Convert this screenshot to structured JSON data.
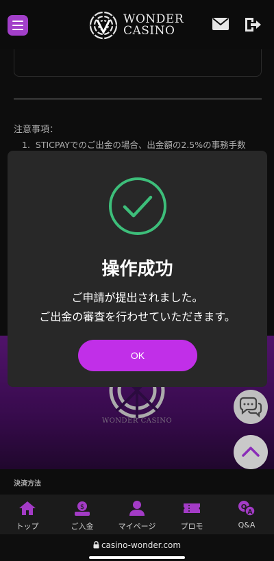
{
  "header": {
    "logo_line1": "WONDER",
    "logo_line2": "CASINO",
    "menu_icon": "hamburger-icon",
    "mail_icon": "mail-icon",
    "logout_icon": "logout-icon"
  },
  "notes": {
    "title": "注意事項：",
    "item1_number": "1.",
    "item1_text": "STICPAYでのご出金の場合、出金額の2.5%の事務手数"
  },
  "modal": {
    "title": "操作成功",
    "message_line1": "ご申請が提出されました。",
    "message_line2": "ご出金の審査を行わせていただきます。",
    "ok_label": "OK",
    "success_icon": "checkmark-circle-icon"
  },
  "promo": {
    "brand_text": "WONDER CASINO"
  },
  "payment": {
    "title": "決済方法"
  },
  "bottom_nav": [
    {
      "label": "トップ",
      "icon": "home-icon"
    },
    {
      "label": "ご入金",
      "icon": "deposit-icon"
    },
    {
      "label": "マイページ",
      "icon": "user-icon"
    },
    {
      "label": "プロモ",
      "icon": "ticket-icon"
    },
    {
      "label": "Q&A",
      "icon": "qa-icon"
    }
  ],
  "browser": {
    "url": "casino-wonder.com"
  },
  "colors": {
    "accent": "#c12fe8",
    "menu_button": "#a23fc9",
    "success": "#3dbe7a",
    "nav_icon": "#a33bc6"
  }
}
